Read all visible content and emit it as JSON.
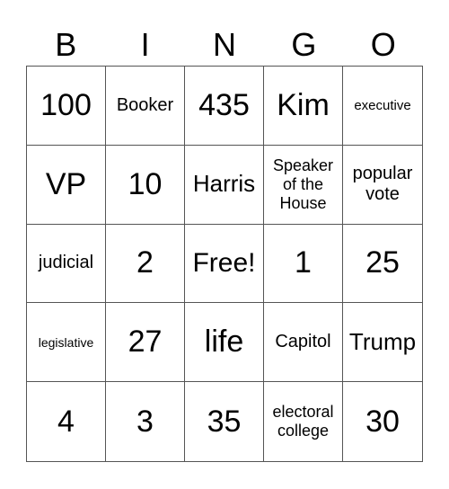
{
  "header": [
    "B",
    "I",
    "N",
    "G",
    "O"
  ],
  "cells": [
    [
      "100",
      "Booker",
      "435",
      "Kim",
      "executive"
    ],
    [
      "VP",
      "10",
      "Harris",
      "Speaker of the House",
      "popular vote"
    ],
    [
      "judicial",
      "2",
      "Free!",
      "1",
      "25"
    ],
    [
      "legislative",
      "27",
      "life",
      "Capitol",
      "Trump"
    ],
    [
      "4",
      "3",
      "35",
      "electoral college",
      "30"
    ]
  ]
}
